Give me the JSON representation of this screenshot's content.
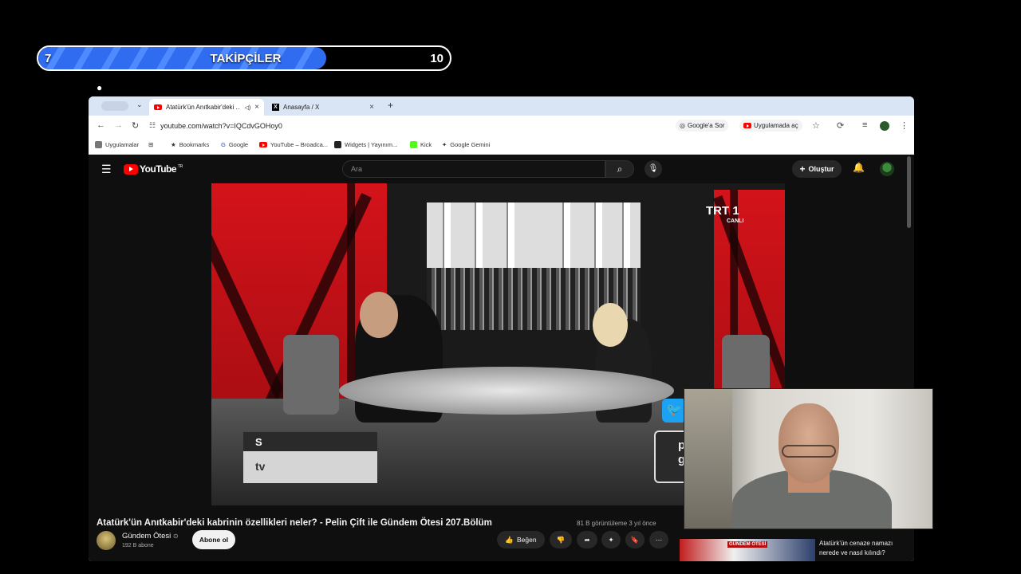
{
  "overlay": {
    "follower_current": "7",
    "follower_title": "TAKİPÇİLER",
    "follower_goal": "10",
    "follower_progress": 0.7
  },
  "browser": {
    "tabs": [
      {
        "label": "Atatürk'ün Anıtkabir'deki ...",
        "active": true
      },
      {
        "label": "Anasayfa / X",
        "active": false
      }
    ],
    "url": "youtube.com/watch?v=IQCdvGOHoy0",
    "address_actions": {
      "google_ask": "Google'a Sor",
      "open_in_app": "Uygulamada aç"
    },
    "bookmarks": [
      "Uygulamalar",
      "Bookmarks",
      "Google",
      "YouTube – Broadca...",
      "Widgets | Yayınım...",
      "Kick",
      "Google Gemini"
    ]
  },
  "youtube": {
    "logo": "YouTube",
    "region": "TR",
    "search_placeholder": "Ara",
    "create_label": "Oluştur",
    "video_overlay": {
      "channel_logo": "TRT 1",
      "live": "CANLI",
      "lower_third_1": "S",
      "lower_third_2": "tv",
      "promo": "p\ngün"
    },
    "title": "Atatürk'ün Anıtkabir'deki kabrinin özellikleri neler? - Pelin Çift ile Gündem Ötesi 207.Bölüm",
    "meta": "81 B görüntüleme  3 yıl önce",
    "channel": {
      "name": "Gündem Ötesi",
      "subscribers": "192 B abone"
    },
    "subscribe_label": "Abone ol",
    "like_label": "Beğen",
    "recommended": {
      "title": "Atatürk'ün cenaze namazı nerede ve nasıl kılındı?",
      "thumb_label": "GÜNDEM ÖTESİ"
    }
  },
  "icons": [
    "apple-icon",
    "hamburger-icon",
    "search-icon",
    "mic-icon",
    "bell-icon",
    "like-icon",
    "dislike-icon",
    "share-icon",
    "sparkle-icon",
    "save-icon",
    "more-icon",
    "twitter-icon"
  ],
  "colors": {
    "youtube_bg": "#0f0f0f",
    "youtube_red": "#ff0000",
    "tabstrip": "#d9e4f5",
    "follower_blue": "#2f6cf0",
    "studio_red": "#d4131a"
  }
}
